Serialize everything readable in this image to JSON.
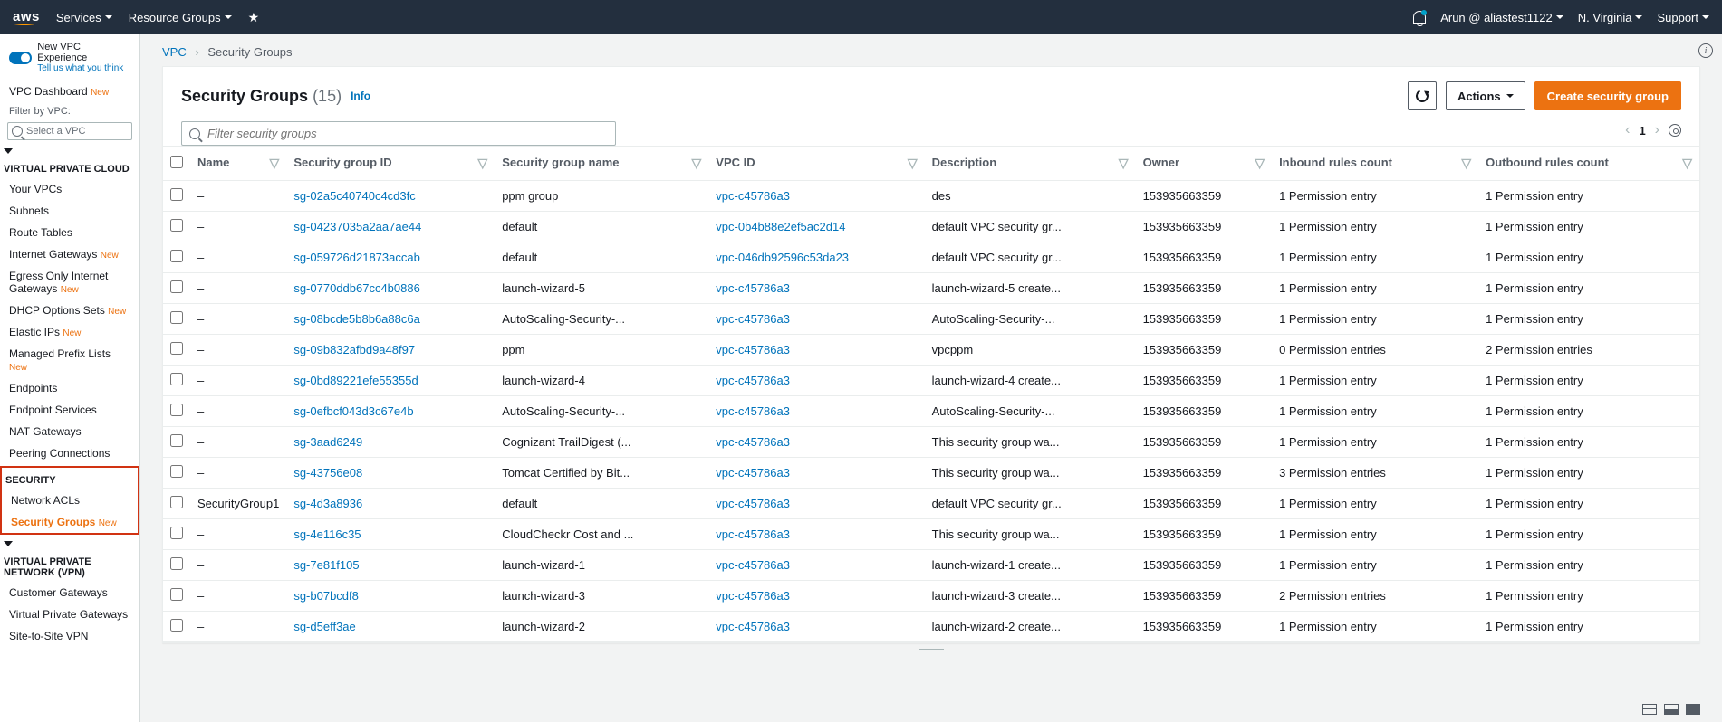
{
  "topnav": {
    "logo": "aws",
    "services": "Services",
    "resourceGroups": "Resource Groups",
    "user": "Arun @ aliastest1122",
    "region": "N. Virginia",
    "support": "Support"
  },
  "sidebar": {
    "newExp": "New VPC Experience",
    "tellUs": "Tell us what you think",
    "dashboard": "VPC Dashboard",
    "filterLabel": "Filter by VPC:",
    "selectVpc": "Select a VPC",
    "vpcHeading": "VIRTUAL PRIVATE CLOUD",
    "yourVpcs": "Your VPCs",
    "subnets": "Subnets",
    "routeTables": "Route Tables",
    "internetGw": "Internet Gateways",
    "egressGw": "Egress Only Internet Gateways",
    "dhcp": "DHCP Options Sets",
    "elasticIps": "Elastic IPs",
    "prefixLists": "Managed Prefix Lists",
    "endpoints": "Endpoints",
    "endpointSvcs": "Endpoint Services",
    "natGw": "NAT Gateways",
    "peering": "Peering Connections",
    "securityHeading": "SECURITY",
    "networkAcls": "Network ACLs",
    "securityGroups": "Security Groups",
    "vpnHeading": "VIRTUAL PRIVATE NETWORK (VPN)",
    "customerGw": "Customer Gateways",
    "vpg": "Virtual Private Gateways",
    "s2s": "Site-to-Site VPN",
    "newBadge": "New"
  },
  "breadcrumb": {
    "vpc": "VPC",
    "current": "Security Groups"
  },
  "panel": {
    "title": "Security Groups",
    "count": "(15)",
    "info": "Info",
    "actions": "Actions",
    "create": "Create security group",
    "filterPlaceholder": "Filter security groups",
    "page": "1"
  },
  "table": {
    "headers": {
      "name": "Name",
      "sgid": "Security group ID",
      "sgname": "Security group name",
      "vpcid": "VPC ID",
      "desc": "Description",
      "owner": "Owner",
      "inbound": "Inbound rules count",
      "outbound": "Outbound rules count"
    },
    "rows": [
      {
        "name": "–",
        "sgid": "sg-02a5c40740c4cd3fc",
        "sgname": "ppm group",
        "vpcid": "vpc-c45786a3",
        "desc": "des",
        "owner": "153935663359",
        "inbound": "1 Permission entry",
        "outbound": "1 Permission entry"
      },
      {
        "name": "–",
        "sgid": "sg-04237035a2aa7ae44",
        "sgname": "default",
        "vpcid": "vpc-0b4b88e2ef5ac2d14",
        "desc": "default VPC security gr...",
        "owner": "153935663359",
        "inbound": "1 Permission entry",
        "outbound": "1 Permission entry"
      },
      {
        "name": "–",
        "sgid": "sg-059726d21873accab",
        "sgname": "default",
        "vpcid": "vpc-046db92596c53da23",
        "desc": "default VPC security gr...",
        "owner": "153935663359",
        "inbound": "1 Permission entry",
        "outbound": "1 Permission entry"
      },
      {
        "name": "–",
        "sgid": "sg-0770ddb67cc4b0886",
        "sgname": "launch-wizard-5",
        "vpcid": "vpc-c45786a3",
        "desc": "launch-wizard-5 create...",
        "owner": "153935663359",
        "inbound": "1 Permission entry",
        "outbound": "1 Permission entry"
      },
      {
        "name": "–",
        "sgid": "sg-08bcde5b8b6a88c6a",
        "sgname": "AutoScaling-Security-...",
        "vpcid": "vpc-c45786a3",
        "desc": "AutoScaling-Security-...",
        "owner": "153935663359",
        "inbound": "1 Permission entry",
        "outbound": "1 Permission entry"
      },
      {
        "name": "–",
        "sgid": "sg-09b832afbd9a48f97",
        "sgname": "ppm",
        "vpcid": "vpc-c45786a3",
        "desc": "vpcppm",
        "owner": "153935663359",
        "inbound": "0 Permission entries",
        "outbound": "2 Permission entries"
      },
      {
        "name": "–",
        "sgid": "sg-0bd89221efe55355d",
        "sgname": "launch-wizard-4",
        "vpcid": "vpc-c45786a3",
        "desc": "launch-wizard-4 create...",
        "owner": "153935663359",
        "inbound": "1 Permission entry",
        "outbound": "1 Permission entry"
      },
      {
        "name": "–",
        "sgid": "sg-0efbcf043d3c67e4b",
        "sgname": "AutoScaling-Security-...",
        "vpcid": "vpc-c45786a3",
        "desc": "AutoScaling-Security-...",
        "owner": "153935663359",
        "inbound": "1 Permission entry",
        "outbound": "1 Permission entry"
      },
      {
        "name": "–",
        "sgid": "sg-3aad6249",
        "sgname": "Cognizant TrailDigest (...",
        "vpcid": "vpc-c45786a3",
        "desc": "This security group wa...",
        "owner": "153935663359",
        "inbound": "1 Permission entry",
        "outbound": "1 Permission entry"
      },
      {
        "name": "–",
        "sgid": "sg-43756e08",
        "sgname": "Tomcat Certified by Bit...",
        "vpcid": "vpc-c45786a3",
        "desc": "This security group wa...",
        "owner": "153935663359",
        "inbound": "3 Permission entries",
        "outbound": "1 Permission entry"
      },
      {
        "name": "SecurityGroup1",
        "sgid": "sg-4d3a8936",
        "sgname": "default",
        "vpcid": "vpc-c45786a3",
        "desc": "default VPC security gr...",
        "owner": "153935663359",
        "inbound": "1 Permission entry",
        "outbound": "1 Permission entry"
      },
      {
        "name": "–",
        "sgid": "sg-4e116c35",
        "sgname": "CloudCheckr Cost and ...",
        "vpcid": "vpc-c45786a3",
        "desc": "This security group wa...",
        "owner": "153935663359",
        "inbound": "1 Permission entry",
        "outbound": "1 Permission entry"
      },
      {
        "name": "–",
        "sgid": "sg-7e81f105",
        "sgname": "launch-wizard-1",
        "vpcid": "vpc-c45786a3",
        "desc": "launch-wizard-1 create...",
        "owner": "153935663359",
        "inbound": "1 Permission entry",
        "outbound": "1 Permission entry"
      },
      {
        "name": "–",
        "sgid": "sg-b07bcdf8",
        "sgname": "launch-wizard-3",
        "vpcid": "vpc-c45786a3",
        "desc": "launch-wizard-3 create...",
        "owner": "153935663359",
        "inbound": "2 Permission entries",
        "outbound": "1 Permission entry"
      },
      {
        "name": "–",
        "sgid": "sg-d5eff3ae",
        "sgname": "launch-wizard-2",
        "vpcid": "vpc-c45786a3",
        "desc": "launch-wizard-2 create...",
        "owner": "153935663359",
        "inbound": "1 Permission entry",
        "outbound": "1 Permission entry"
      }
    ]
  }
}
